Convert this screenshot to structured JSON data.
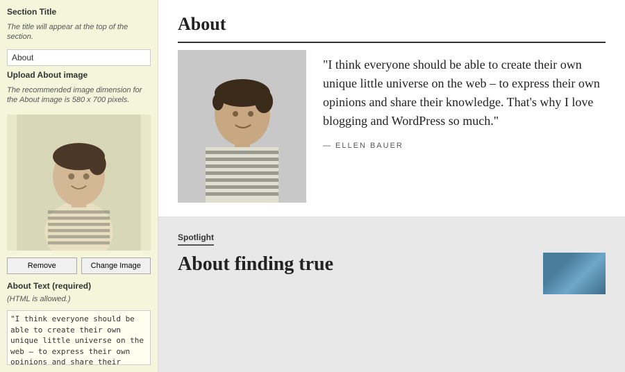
{
  "left_panel": {
    "section_title_label": "Section Title",
    "section_title_hint": "The title will appear at the top of the section.",
    "section_title_value": "About",
    "upload_image_label": "Upload About image",
    "upload_image_hint": "The recommended image dimension for the About image is 580 x 700 pixels.",
    "remove_btn": "Remove",
    "change_image_btn": "Change Image",
    "about_text_label": "About Text (required)",
    "about_text_hint": "(HTML is allowed.)",
    "about_text_value": "\"I think everyone should be able to create their own unique little universe on the web – to express their own opinions and share their knowledge. That's why I love blogging and"
  },
  "right_panel": {
    "about": {
      "title": "About",
      "quote": "\"I think everyone should be able to create their own unique little universe on the web – to express their own opinions and share their knowledge. That's why I love blogging and WordPress so much.\"",
      "attribution": "— ELLEN BAUER"
    },
    "spotlight": {
      "label": "Spotlight",
      "title_partial": "About finding true"
    }
  }
}
